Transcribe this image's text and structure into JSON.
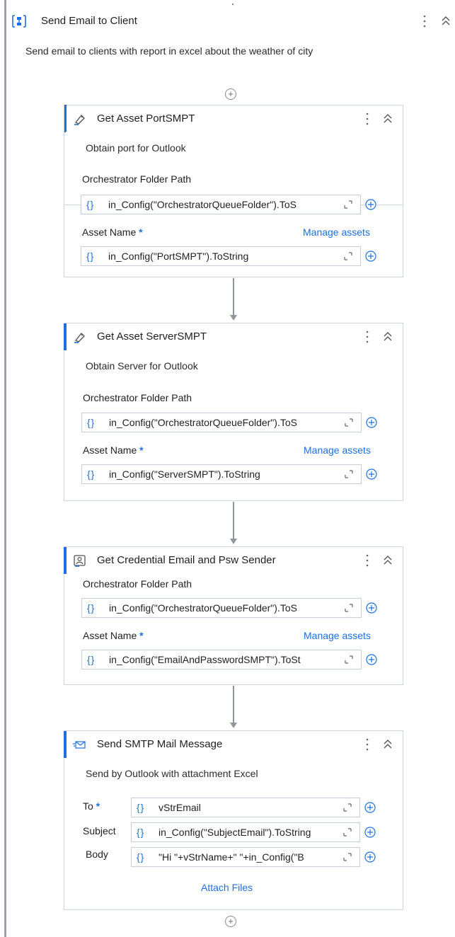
{
  "sequence": {
    "title": "Send Email to Client",
    "description": "Send email to clients with report in excel about the weather of city"
  },
  "activities": [
    {
      "title": "Get Asset PortSMPT",
      "icon": "asset-icon",
      "description": "Obtain port for Outlook",
      "folder_label": "Orchestrator Folder Path",
      "folder_value": "in_Config(\"OrchestratorQueueFolder\").ToS",
      "asset_label": "Asset Name",
      "asset_value": "in_Config(\"PortSMPT\").ToString",
      "manage_link": "Manage assets"
    },
    {
      "title": "Get Asset ServerSMPT",
      "icon": "asset-icon",
      "description": "Obtain Server for Outlook",
      "folder_label": "Orchestrator Folder Path",
      "folder_value": "in_Config(\"OrchestratorQueueFolder\").ToS",
      "asset_label": "Asset Name",
      "asset_value": "in_Config(\"ServerSMPT\").ToString",
      "manage_link": "Manage assets"
    },
    {
      "title": "Get Credential Email and Psw Sender",
      "icon": "credential-icon",
      "folder_label": "Orchestrator Folder Path",
      "folder_value": "in_Config(\"OrchestratorQueueFolder\").ToS",
      "asset_label": "Asset Name",
      "asset_value": "in_Config(\"EmailAndPasswordSMPT\").ToSt",
      "manage_link": "Manage assets"
    },
    {
      "title": "Send SMTP Mail Message",
      "icon": "mail-icon",
      "description": "Send by Outlook with attachment Excel",
      "to_label": "To",
      "to_value": "vStrEmail",
      "subject_label": "Subject",
      "subject_value": "in_Config(\"SubjectEmail\").ToString",
      "body_label": "Body",
      "body_value": "\"Hi \"+vStrName+\" \"+in_Config(\"B",
      "attach_link": "Attach Files"
    }
  ],
  "common": {
    "brace_glyph": "{}",
    "required_mark": "*",
    "plus_glyph": "+"
  },
  "colors": {
    "accent": "#1f6fe0",
    "border": "#cfd5dc",
    "connector": "#8f969d"
  }
}
